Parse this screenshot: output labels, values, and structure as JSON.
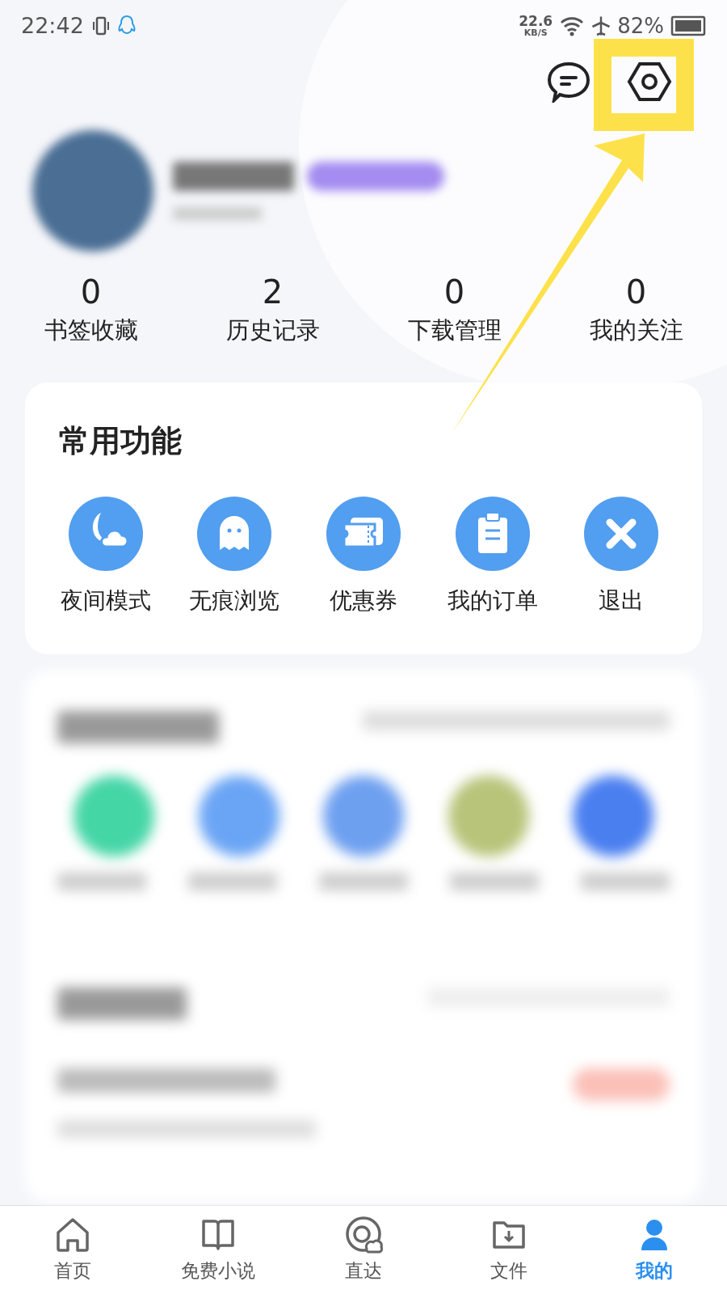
{
  "status_bar": {
    "time": "22:42",
    "speed_value": "22.6",
    "speed_unit": "KB/S",
    "battery": "82%"
  },
  "stats": [
    {
      "count": "0",
      "label": "书签收藏"
    },
    {
      "count": "2",
      "label": "历史记录"
    },
    {
      "count": "0",
      "label": "下载管理"
    },
    {
      "count": "0",
      "label": "我的关注"
    }
  ],
  "common_functions": {
    "title": "常用功能",
    "items": [
      {
        "kind": "night",
        "label": "夜间模式"
      },
      {
        "kind": "ghost",
        "label": "无痕浏览"
      },
      {
        "kind": "ticket",
        "label": "优惠券"
      },
      {
        "kind": "order",
        "label": "我的订单"
      },
      {
        "kind": "exit",
        "label": "退出"
      }
    ]
  },
  "bottom_nav": [
    {
      "kind": "home",
      "label": "首页",
      "selected": false
    },
    {
      "kind": "book",
      "label": "免费小说",
      "selected": false
    },
    {
      "kind": "direct",
      "label": "直达",
      "selected": false
    },
    {
      "kind": "file",
      "label": "文件",
      "selected": false
    },
    {
      "kind": "me",
      "label": "我的",
      "selected": true
    }
  ]
}
